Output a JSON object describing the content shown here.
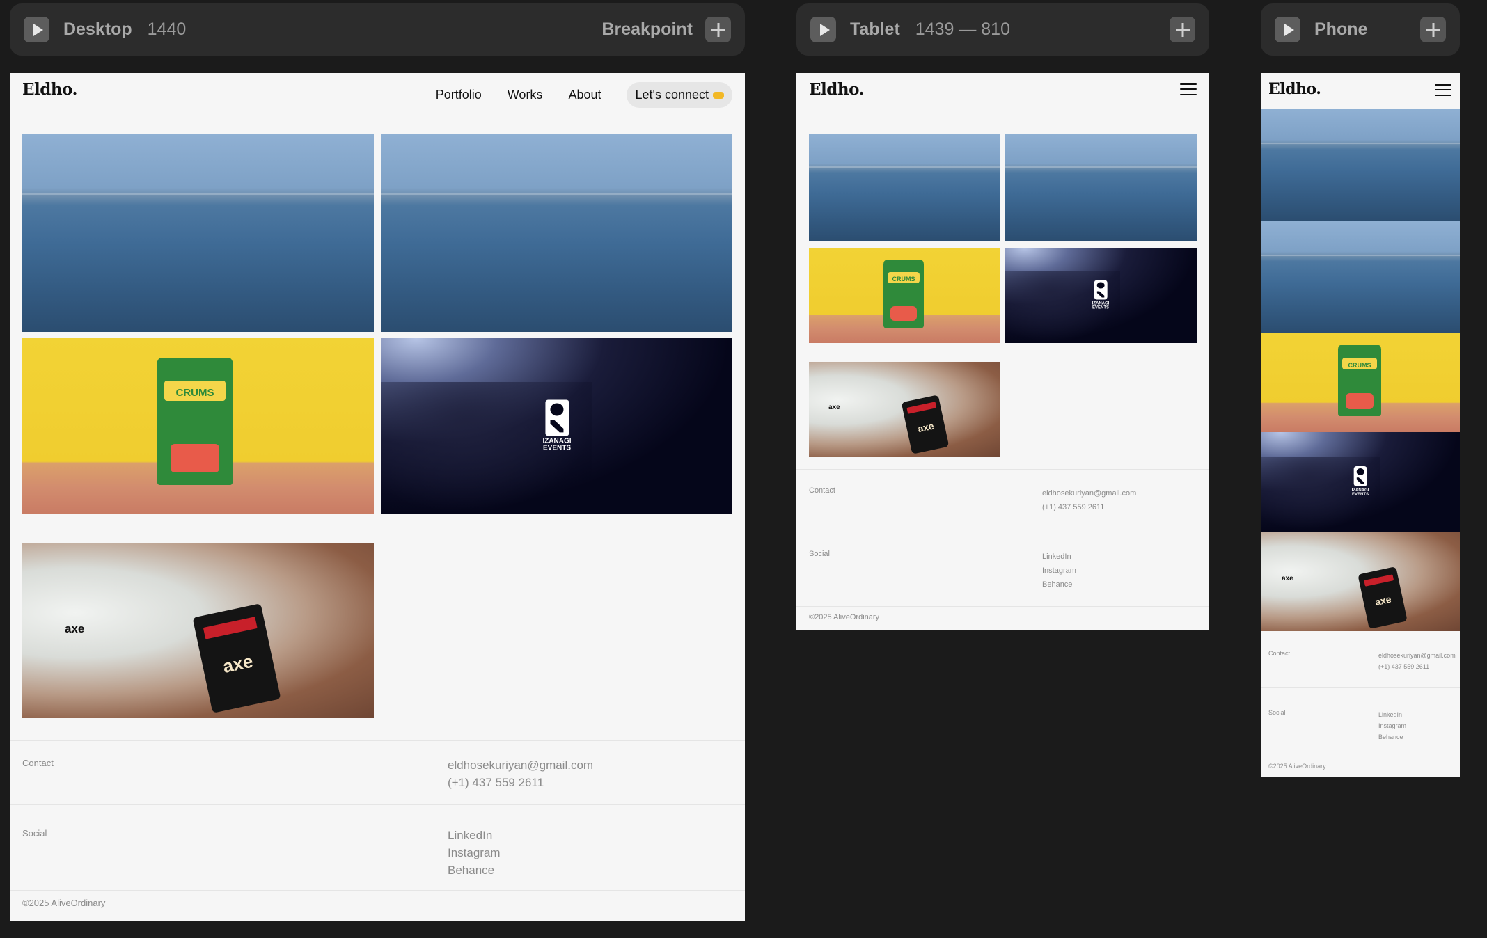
{
  "breakpoints": {
    "desktop": {
      "name": "Desktop",
      "width": "1440",
      "right_label": "Breakpoint"
    },
    "tablet": {
      "name": "Tablet",
      "range": "1439 — 810"
    },
    "phone": {
      "name": "Phone"
    }
  },
  "site": {
    "logo": "Eldho.",
    "nav": [
      "Portfolio",
      "Works",
      "About"
    ],
    "cta": "Let's connect",
    "projects": {
      "crums": "CRUMS",
      "izanagi_line1": "IZANAGI",
      "izanagi_line2": "EVENTS",
      "axe": "axe"
    },
    "footer": {
      "contact_label": "Contact",
      "email": "eldhosekuriyan@gmail.com",
      "phone": "(+1) 437 559 2611",
      "social_label": "Social",
      "social": [
        "LinkedIn",
        "Instagram",
        "Behance"
      ],
      "copyright": "©2025 AliveOrdinary"
    }
  },
  "colors": {
    "canvas": "#1b1b1b",
    "toolbar": "#2c2c2c",
    "page": "#f6f6f6",
    "accent": "#f2b825"
  },
  "icons": [
    "play-icon",
    "plus-icon",
    "menu-icon",
    "handshake-icon"
  ]
}
